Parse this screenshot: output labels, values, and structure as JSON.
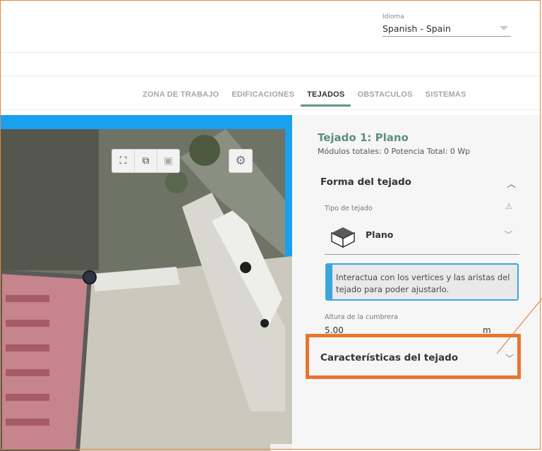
{
  "language": {
    "label": "Idioma",
    "value": "Spanish - Spain"
  },
  "tabs": [
    {
      "label": "ZONA DE TRABAJO",
      "active": false
    },
    {
      "label": "EDIFICACIONES",
      "active": false
    },
    {
      "label": "TEJADOS",
      "active": true
    },
    {
      "label": "OBSTACULOS",
      "active": false
    },
    {
      "label": "SISTEMAS",
      "active": false
    }
  ],
  "map_toolbar": {
    "icons": [
      "fullscreen-icon",
      "cube-view-icon",
      "camera-icon"
    ],
    "settings_icon": "gear-icon"
  },
  "panel": {
    "title": "Tejado 1: Plano",
    "subtitle": "Módulos totales: 0 Potencia Total: 0 Wp",
    "section_roof_shape": "Forma del tejado",
    "roof_type_label": "Tipo de tejado",
    "roof_type_value": "Plano",
    "info_text": "Interactua con los vertices y las aristas del tejado para poder ajustarlo.",
    "ridge_height_label": "Altura de la cumbrera",
    "ridge_height_value": "5.00",
    "ridge_height_unit": "m",
    "section_roof_features": "Características del tejado"
  },
  "colors": {
    "accent": "#5f9880",
    "info_border": "#3aa6dd",
    "highlight": "#e8752e",
    "map_header": "#19a0ee"
  }
}
